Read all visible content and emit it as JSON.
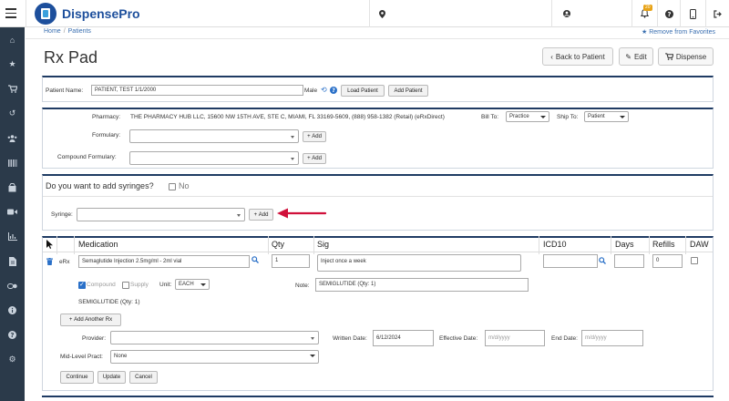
{
  "brand": {
    "name": "DispensePro",
    "notification_count": "20"
  },
  "breadcrumb": {
    "home": "Home",
    "patients": "Patients"
  },
  "favorites": "Remove from Favorites",
  "page_title": "Rx Pad",
  "header_buttons": {
    "back": "Back to Patient",
    "edit": "Edit",
    "dispense": "Dispense"
  },
  "patient": {
    "label": "Patient Name:",
    "value": "PATIENT, TEST 1/1/2000",
    "gender": "Male",
    "load": "Load Patient",
    "add": "Add Patient"
  },
  "pharmacy": {
    "label": "Pharmacy:",
    "value": "THE PHARMACY HUB LLC, 15600 NW 15TH AVE, STE C, MIAMI, FL 33169-5609, (888) 958-1382 (Retail) (eRxDirect)",
    "bill_to_label": "Bill To:",
    "bill_to": "Practice",
    "ship_to_label": "Ship To:",
    "ship_to": "Patient"
  },
  "formulary": {
    "label": "Formulary:",
    "add": "Add"
  },
  "compound": {
    "label": "Compound Formulary:",
    "add": "Add"
  },
  "syringes": {
    "question": "Do you want to add syringes?",
    "no": "No",
    "label": "Syringe:",
    "add": "Add"
  },
  "rx_table": {
    "headers": {
      "medication": "Medication",
      "qty": "Qty",
      "sig": "Sig",
      "icd10": "ICD10",
      "days": "Days",
      "refills": "Refills",
      "daw": "DAW"
    },
    "row": {
      "type": "eRx",
      "medication": "Semaglutide Injection 2.5mg/ml - 2ml vial",
      "qty": "1",
      "sig": "Inject once a week",
      "refills": "0",
      "compound": "Compound",
      "supply": "Supply",
      "unit_label": "Unit:",
      "unit": "EACH",
      "note_label": "Note:",
      "note": "SEMIGLUTIDE (Qty: 1)",
      "summary": "SEMIGLUTIDE (Qty: 1)"
    }
  },
  "add_another": "Add Another Rx",
  "provider": {
    "label": "Provider:",
    "written_label": "Written Date:",
    "written": "6/12/2024",
    "effective_label": "Effective Date:",
    "effective_ph": "m/d/yyyy",
    "end_label": "End Date:",
    "end_ph": "m/d/yyyy"
  },
  "midlevel": {
    "label": "Mid-Level Pract:",
    "value": "None"
  },
  "actions": {
    "continue": "Continue",
    "update": "Update",
    "cancel": "Cancel"
  },
  "colors": {
    "navy": "#1f3b63",
    "link": "#3a6fb0",
    "arrow": "#d0103a",
    "sidebar": "#2b3a4a"
  }
}
